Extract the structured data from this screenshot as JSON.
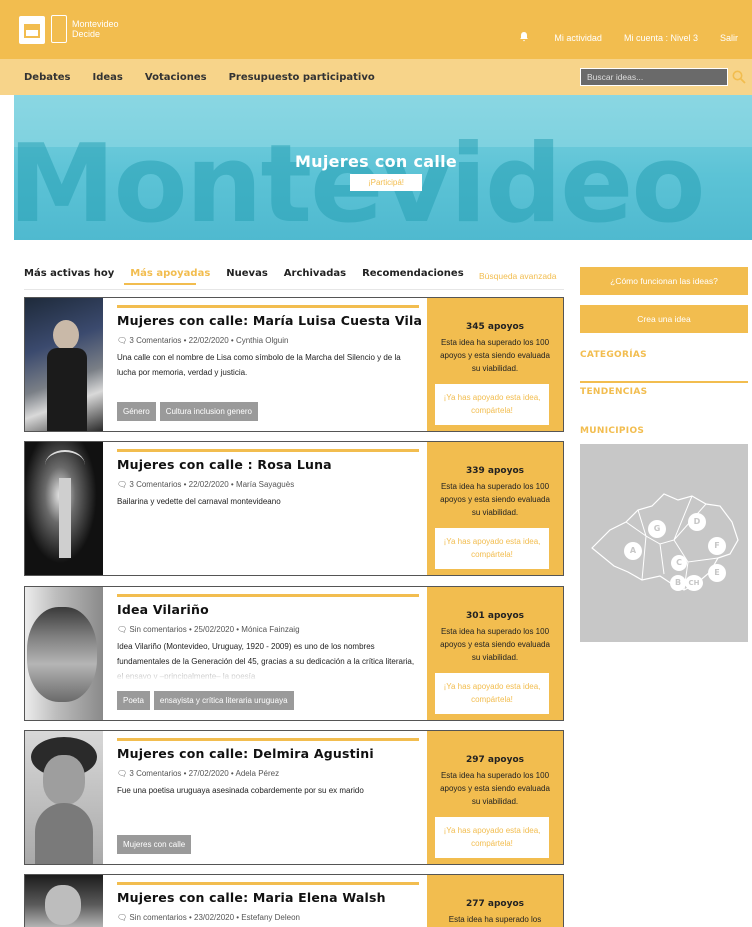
{
  "header": {
    "brand_line1": "Montevideo",
    "brand_line2": "Decide",
    "links": [
      "Mi actividad",
      "Mi cuenta : Nivel 3",
      "Salir"
    ]
  },
  "nav": {
    "items": [
      "Debates",
      "Ideas",
      "Votaciones",
      "Presupuesto participativo"
    ],
    "search_placeholder": "Buscar ideas..."
  },
  "hero": {
    "background_text": "Montevideo",
    "title": "Mujeres con calle",
    "button": "¡Participá!"
  },
  "tabs": {
    "items": [
      "Más activas hoy",
      "Más apoyadas",
      "Nuevas",
      "Archivadas",
      "Recomendaciones"
    ],
    "active": "Más apoyadas",
    "advanced_search": "Búsqueda avanzada"
  },
  "ideas": [
    {
      "title": "Mujeres con calle: María Luisa Cuesta Vila",
      "meta": "3 Comentarios  •  22/02/2020  •  Cynthia Olguin",
      "description": "Una calle con el nombre de Lisa como símbolo de la Marcha del Silencio y de la lucha por memoria, verdad y justicia.",
      "tags": [
        "Género",
        "Cultura inclusion genero"
      ],
      "supports": "345 apoyos",
      "support_text": "Esta idea ha superado los 100 apoyos y esta siendo evaluada su viabilidad.",
      "supported_msg": "¡Ya has apoyado esta idea, compártela!"
    },
    {
      "title": "Mujeres con calle : Rosa Luna",
      "meta": "3 Comentarios  •  22/02/2020  •  María Sayaguès",
      "description": "Bailarina y vedette del carnaval montevideano",
      "tags": [],
      "supports": "339 apoyos",
      "support_text": "Esta idea ha superado los 100 apoyos y esta siendo evaluada su viabilidad.",
      "supported_msg": "¡Ya has apoyado esta idea, compártela!"
    },
    {
      "title": "Idea Vilariño",
      "meta": "Sin comentarios  •  25/02/2020  •  Mónica Fainzaig",
      "description": "Idea Vilariño (Montevideo, Uruguay, 1920 - 2009) es uno de los nombres fundamentales de la Generación del 45, gracias a su dedicación a la crítica literaria, el ensayo y –principalmente– la poesía",
      "tags": [
        "Poeta",
        "ensayista y crítica literaria uruguaya"
      ],
      "supports": "301 apoyos",
      "support_text": "Esta idea ha superado los 100 apoyos y esta siendo evaluada su viabilidad.",
      "supported_msg": "¡Ya has apoyado esta idea, compártela!"
    },
    {
      "title": "Mujeres con calle: Delmira Agustini",
      "meta": "3 Comentarios  •  27/02/2020  •  Adela Pérez",
      "description": "Fue una poetisa uruguaya asesinada cobardemente por su ex marido",
      "tags": [
        "Mujeres con calle"
      ],
      "supports": "297 apoyos",
      "support_text": "Esta idea ha superado los 100 apoyos y esta siendo evaluada su viabilidad.",
      "supported_msg": "¡Ya has apoyado esta idea, compártela!"
    },
    {
      "title": "Mujeres con calle: Maria Elena Walsh",
      "meta": "Sin comentarios  •  23/02/2020  •  Estefany Deleon",
      "description": "",
      "tags": [],
      "supports": "277 apoyos",
      "support_text": "Esta idea ha superado los",
      "supported_msg": ""
    }
  ],
  "sidebar": {
    "how_button": "¿Cómo funcionan las ideas?",
    "create_button": "Crea una idea",
    "categories": "CATEGORÍAS",
    "trends": "TENDENCIAS",
    "municipalities": "MUNICIPIOS",
    "map_labels": [
      "A",
      "B",
      "C",
      "CH",
      "D",
      "E",
      "F",
      "G"
    ]
  },
  "colors": {
    "accent": "#f2bd4f",
    "nav_bg": "#f7d48a",
    "tag_bg": "#9a9a9a"
  }
}
